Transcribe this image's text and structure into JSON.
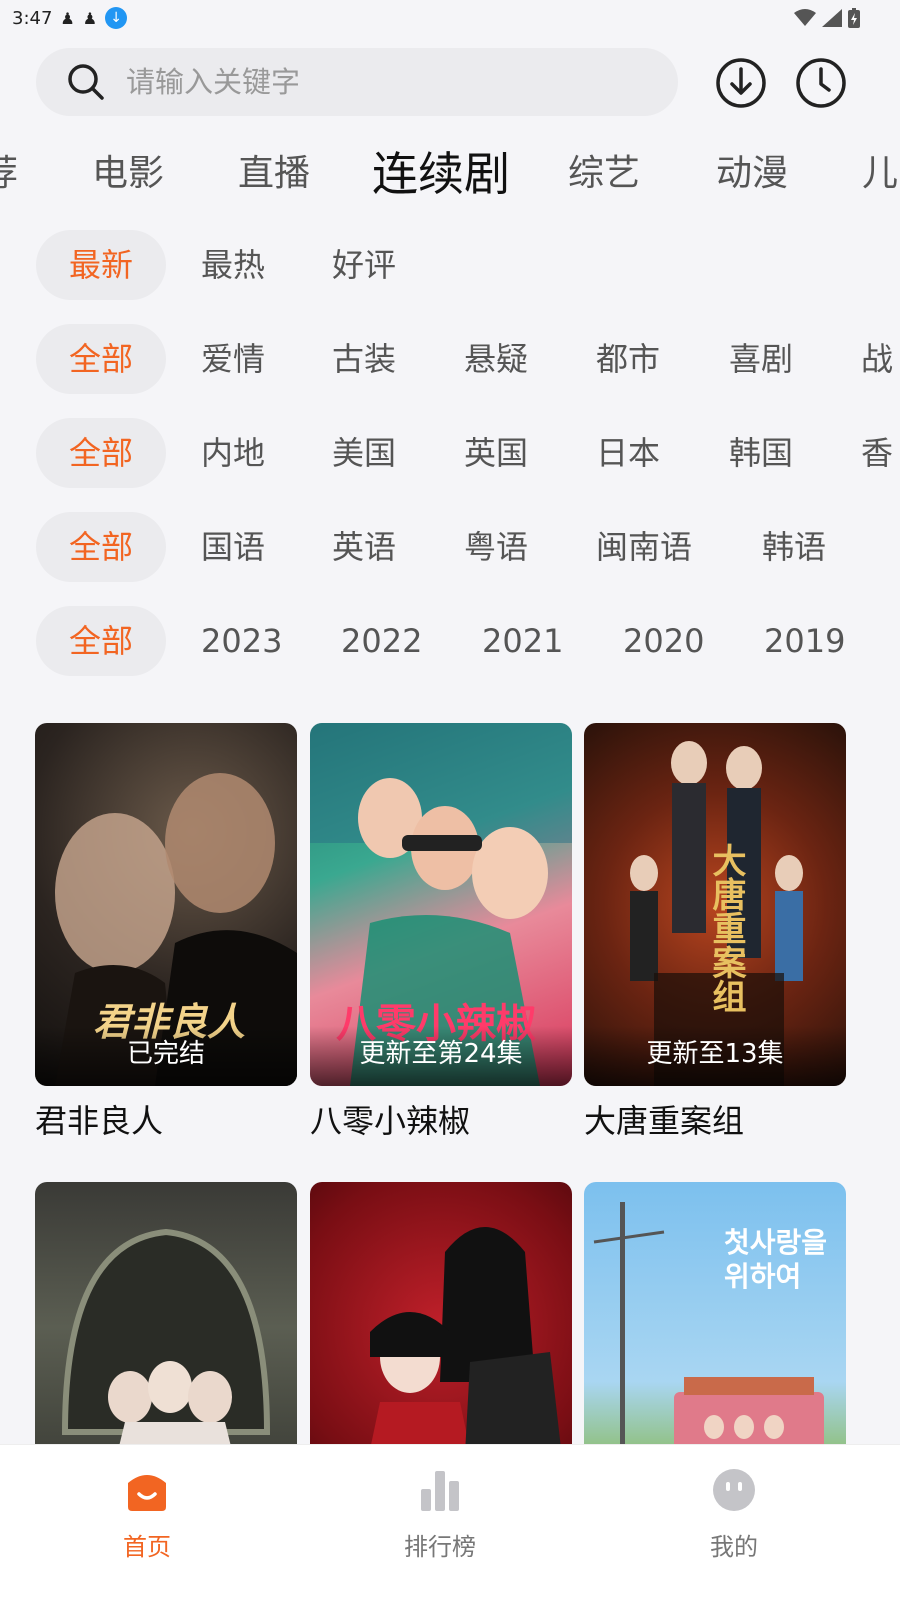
{
  "status_bar": {
    "time": "3:47"
  },
  "search": {
    "placeholder": "请输入关键字"
  },
  "icons": {
    "search": "search-icon",
    "download": "download-icon",
    "history": "history-clock-icon"
  },
  "category_tabs": {
    "items": [
      "荐",
      "电影",
      "直播",
      "连续剧",
      "综艺",
      "动漫",
      "儿"
    ],
    "active": "连续剧"
  },
  "filters": {
    "sort": [
      "最新",
      "最热",
      "好评"
    ],
    "genre": [
      "全部",
      "爱情",
      "古装",
      "悬疑",
      "都市",
      "喜剧",
      "战"
    ],
    "region": [
      "全部",
      "内地",
      "美国",
      "英国",
      "日本",
      "韩国",
      "香"
    ],
    "language": [
      "全部",
      "国语",
      "英语",
      "粤语",
      "闽南语",
      "韩语"
    ],
    "year": [
      "全部",
      "2023",
      "2022",
      "2021",
      "2020",
      "2019"
    ]
  },
  "cards": [
    {
      "title": "君非良人",
      "badge": "已完结",
      "poster_text": "君非良人"
    },
    {
      "title": "八零小辣椒",
      "badge": "更新至第24集",
      "poster_text": "八零小辣椒"
    },
    {
      "title": "大唐重案组",
      "badge": "更新至13集",
      "poster_text": "大唐重案组"
    },
    {
      "title": "",
      "badge": "",
      "poster_text": ""
    },
    {
      "title": "",
      "badge": "",
      "poster_text": ""
    },
    {
      "title": "",
      "badge": "",
      "poster_text": "첫사랑을 위하여"
    }
  ],
  "bottom_nav": {
    "items": [
      {
        "label": "首页",
        "icon": "home-icon",
        "active": true
      },
      {
        "label": "排行榜",
        "icon": "bar-chart-icon",
        "active": false
      },
      {
        "label": "我的",
        "icon": "profile-face-icon",
        "active": false
      }
    ]
  },
  "colors": {
    "accent": "#f26522",
    "background": "#f5f5f8",
    "chip_bg": "#ebebee"
  }
}
